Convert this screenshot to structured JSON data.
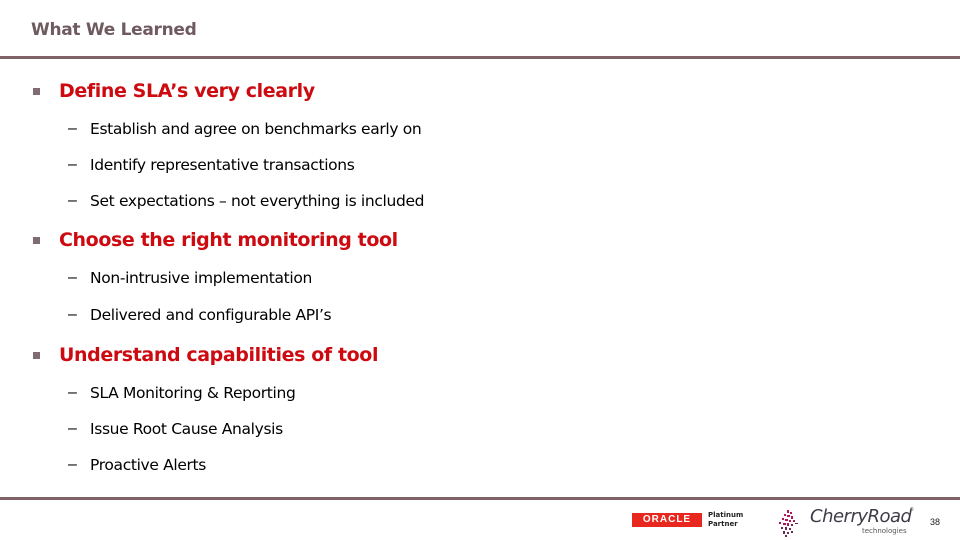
{
  "slide": {
    "title": "What We Learned",
    "page_number": "38",
    "colors": {
      "title": "#6f5a60",
      "rule": "#7f6166",
      "heading": "#cc0a10",
      "bullet": "#7f6c72",
      "oracle_red": "#e8281f"
    }
  },
  "sections": [
    {
      "heading": "Define SLA’s very clearly",
      "items": [
        "Establish and agree on benchmarks early on",
        "Identify representative transactions",
        "Set expectations – not everything is included"
      ]
    },
    {
      "heading": "Choose the right monitoring tool",
      "items": [
        "Non-intrusive implementation",
        "Delivered and configurable API’s"
      ]
    },
    {
      "heading": "Understand capabilities of tool",
      "items": [
        "SLA Monitoring & Reporting",
        "Issue Root Cause Analysis",
        "Proactive Alerts"
      ]
    }
  ],
  "sub_bullet_glyph": "–",
  "footer": {
    "oracle_logo_text": "ORACLE",
    "oracle_badge_line1": "Platinum",
    "oracle_badge_line2": "Partner",
    "cherryroad_name": "CherryRoad",
    "cherryroad_tm": "®",
    "cherryroad_sub": "technologies"
  }
}
